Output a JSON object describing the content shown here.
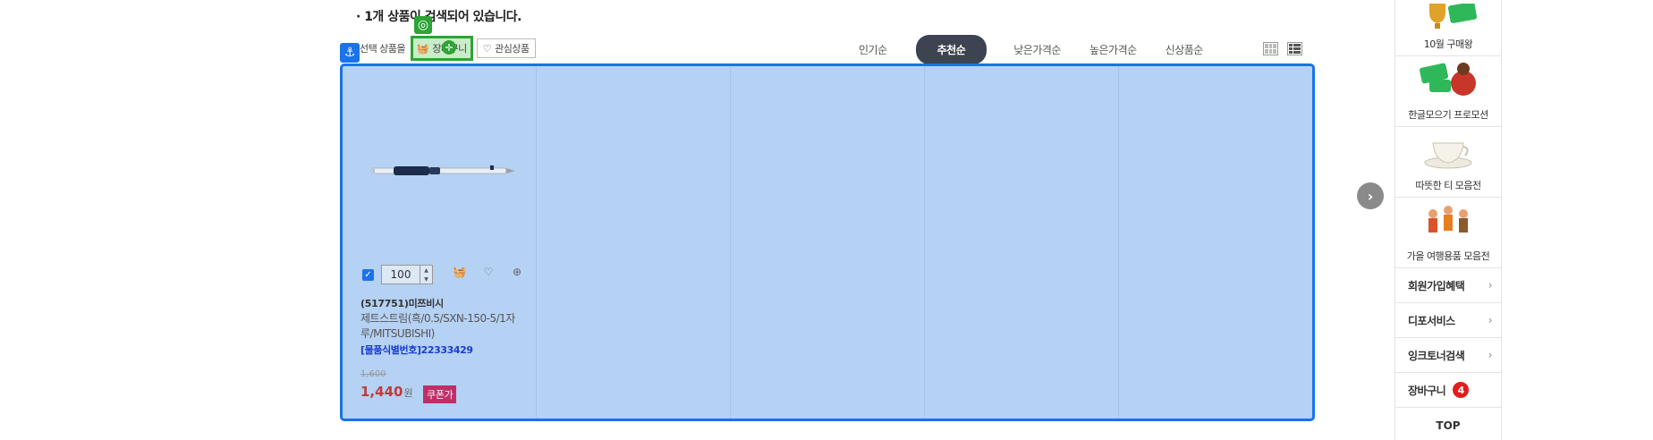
{
  "result": {
    "text": "· 1개 상품이 검색되어 있습니다."
  },
  "toolbar": {
    "select_label": "선택 상품을",
    "cart_label": "장바구니",
    "wish_label": "관심상품"
  },
  "sort": {
    "items": [
      "인기순",
      "추천순",
      "낮은가격순",
      "높은가격순",
      "신상품순"
    ],
    "active": "추천순"
  },
  "product": {
    "quantity": "100",
    "code": "(517751)미쯔비시",
    "name": "제트스트림(흑/0.5/SXN-150-5/1자루/MITSUBISHI)",
    "item_id": "[물품식별번호]22333429",
    "old_price": "1,600",
    "price": "1,440",
    "currency": "원",
    "coupon": "쿠폰가"
  },
  "side": {
    "promos": [
      "10월 구매왕",
      "한글모으기 프로모션",
      "따뜻한 티 모음전",
      "가을 여행용품 모음전"
    ],
    "links": [
      "회원가입혜택",
      "디포서비스",
      "잉크토너검색"
    ],
    "cart_label": "장바구니",
    "cart_count": "4",
    "top_label": "TOP"
  },
  "colors": {
    "accent": "#1a73e8",
    "active_sort": "#3d4350",
    "price": "#c23a3a",
    "coupon": "#c22d68",
    "highlight": "#2da436"
  }
}
